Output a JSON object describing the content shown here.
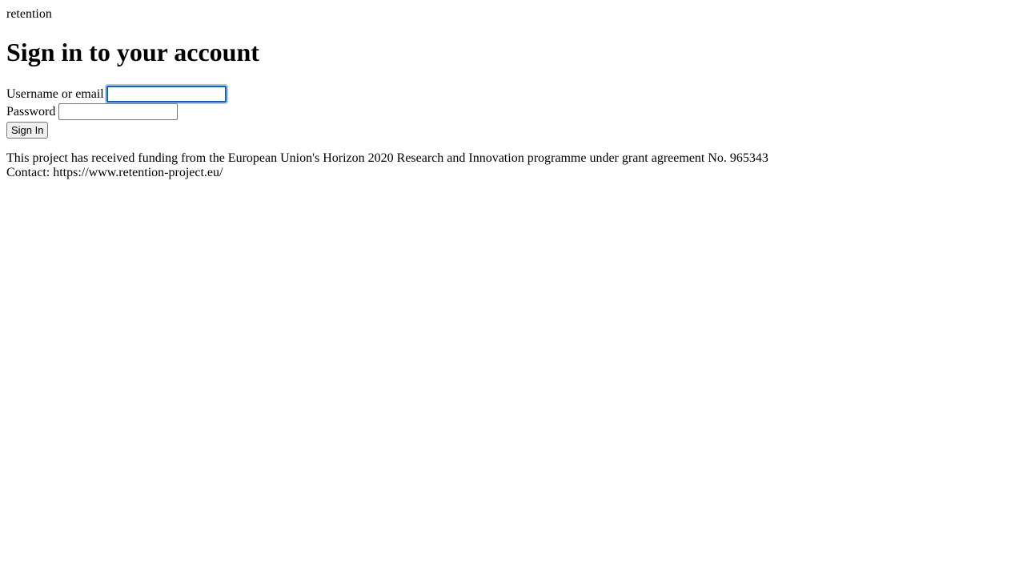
{
  "brand": "retention",
  "heading": "Sign in to your account",
  "form": {
    "username_label": "Username or email",
    "username_value": "",
    "password_label": "Password",
    "password_value": "",
    "submit_label": "Sign In"
  },
  "footer": {
    "funding_text": " This project has received funding from the European Union's Horizon 2020 Research and Innovation programme under grant agreement No. 965343",
    "contact_text": "Contact: https://www.retention-project.eu/"
  }
}
